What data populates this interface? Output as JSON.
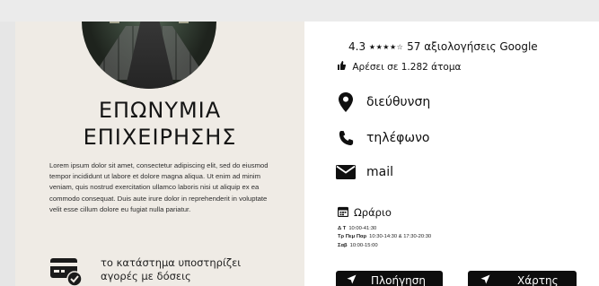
{
  "business": {
    "name_line1": "ΕΠΩΝΥΜΙΑ",
    "name_line2": "ΕΠΙΧΕΙΡΗΣΗΣ",
    "description": "Lorem ipsum dolor sit amet, consectetur adipiscing elit, sed do eiusmod tempor incididunt ut labore et dolore magna aliqua. Ut enim ad minim veniam, quis nostrud exercitation ullamco laboris nisi ut aliquip ex ea commodo consequat. Duis aute irure dolor in reprehenderit in voluptate velit esse cillum dolore eu fugiat nulla pariatur.",
    "payment_line1": "το κατάστημα υποστηρίζει",
    "payment_line2": "αγορές με δόσεις"
  },
  "rating": {
    "score": "4.3",
    "stars": "★★★★☆",
    "reviews": "57 αξιολογήσεις Google",
    "likes": "Αρέσει σε 1.282 άτομα"
  },
  "contact": {
    "address": "διεύθυνση",
    "phone": "τηλέφωνο",
    "mail": "mail"
  },
  "hours": {
    "title": "Ωράριο",
    "rows": [
      {
        "days": "Δ Τ",
        "times": "10:00-41:30"
      },
      {
        "days": "Τρ Πεμ Παρ",
        "times": "10:30-14:30 & 17:30-20:30"
      },
      {
        "days": "Σαβ",
        "times": "10:00-15:00"
      }
    ]
  },
  "buttons": {
    "navigate": "Πλοήγηση",
    "map": "Χάρτης"
  },
  "icons": {
    "location": "map-pin-icon",
    "phone": "phone-icon",
    "mail": "envelope-icon",
    "calendar": "calendar-icon",
    "thumb": "thumbs-up-icon",
    "arrow": "navigation-arrow-icon",
    "payment": "credit-card-check-icon"
  }
}
